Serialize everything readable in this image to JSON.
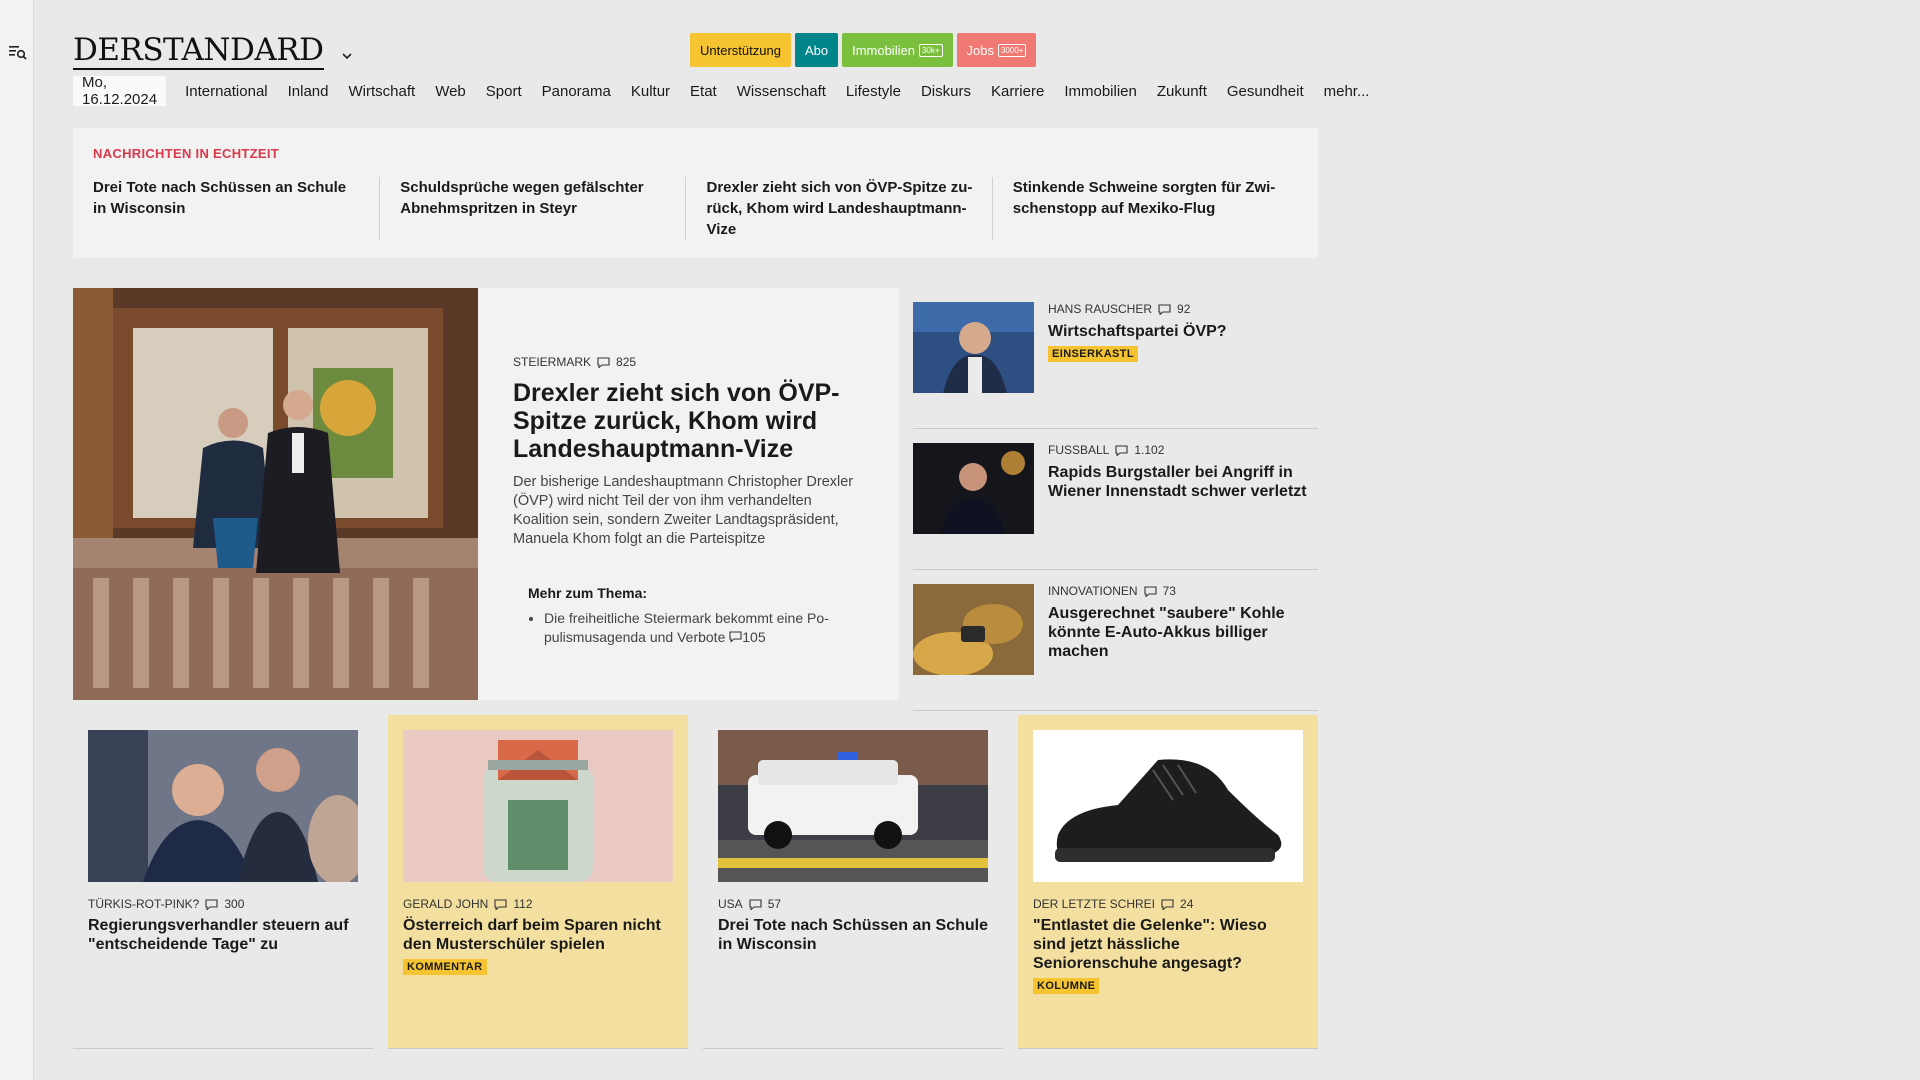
{
  "brand": {
    "logo": "DERSTANDARD"
  },
  "top_buttons": {
    "support": "Unterstützung",
    "abo": "Abo",
    "immobilien": "Immobilien",
    "immobilien_tag": "30k+",
    "jobs": "Jobs",
    "jobs_tag": "3000+"
  },
  "nav": {
    "date": "Mo, 16.12.2024",
    "items": [
      "International",
      "Inland",
      "Wirtschaft",
      "Web",
      "Sport",
      "Panorama",
      "Kultur",
      "Etat",
      "Wissenschaft",
      "Lifestyle",
      "Diskurs",
      "Karriere",
      "Immobilien",
      "Zukunft",
      "Gesundheit",
      "mehr..."
    ]
  },
  "ticker": {
    "title": "NACHRICHTEN IN ECHTZEIT",
    "items": [
      "Drei Tote nach Schüssen an Schule in Wisconsin",
      "Schuldsprüche wegen gefälschter Ab­nehmspritzen in Steyr",
      "Drexler zieht sich von ÖVP-Spitze zu­rück, Khom wird Landeshauptmann-Vize",
      "Stinkende Schweine sorgten für Zwi­schenstopp auf Mexiko-Flug"
    ]
  },
  "lead": {
    "kicker": "STEIERMARK",
    "comments": "825",
    "title": "Drexler zieht sich von ÖVP-Spitze zurück, Khom wird Lan­deshauptmann-Vize",
    "description": "Der bisherige Landeshauptmann Christopher Drexler (ÖVP) wird nicht Teil der von ihm verhandelten Koalition sein, sondern Zweiter Land­tagspräsident, Manuela Khom folgt an die Parteispitze",
    "more_title": "Mehr zum Thema:",
    "more_item": "Die freiheitliche Steiermark bekommt eine Po­pulismusagenda und Verbote",
    "more_comments": "105"
  },
  "side_stories": [
    {
      "kicker": "HANS RAUSCHER",
      "comments": "92",
      "title": "Wirtschaftspartei ÖVP?",
      "badge": "EINSERKASTL"
    },
    {
      "kicker": "FUSSBALL",
      "comments": "1.102",
      "title": "Rapids Burgstaller bei Angriff in Wiener Innenstadt schwer verletzt",
      "badge": ""
    },
    {
      "kicker": "INNOVATIONEN",
      "comments": "73",
      "title": "Ausgerechnet \"saubere\" Kohle könnte E-Auto-Akkus billiger machen",
      "badge": ""
    }
  ],
  "cards": [
    {
      "kicker": "TÜRKIS-ROT-PINK?",
      "comments": "300",
      "title": "Regierungsverhandler steuern auf \"entscheidende Tage\" zu",
      "badge": ""
    },
    {
      "kicker": "GERALD JOHN",
      "comments": "112",
      "title": "Österreich darf beim Sparen nicht den Musterschüler spielen",
      "badge": "KOMMENTAR"
    },
    {
      "kicker": "USA",
      "comments": "57",
      "title": "Drei Tote nach Schüssen an Schule in Wisconsin",
      "badge": ""
    },
    {
      "kicker": "DER LETZTE SCHREI",
      "comments": "24",
      "title": "\"Entlastet die Gelenke\": Wieso sind jetzt hässliche Seniorenschuhe angesagt?",
      "badge": "KOLUMNE"
    }
  ],
  "colors": {
    "accent_red": "#d83a4c",
    "badge_yellow": "#f5c430",
    "abo_teal": "#00858a",
    "immo_green": "#7bbf3e",
    "jobs_red": "#f07a73",
    "card_yellow": "#f3e0a0"
  }
}
